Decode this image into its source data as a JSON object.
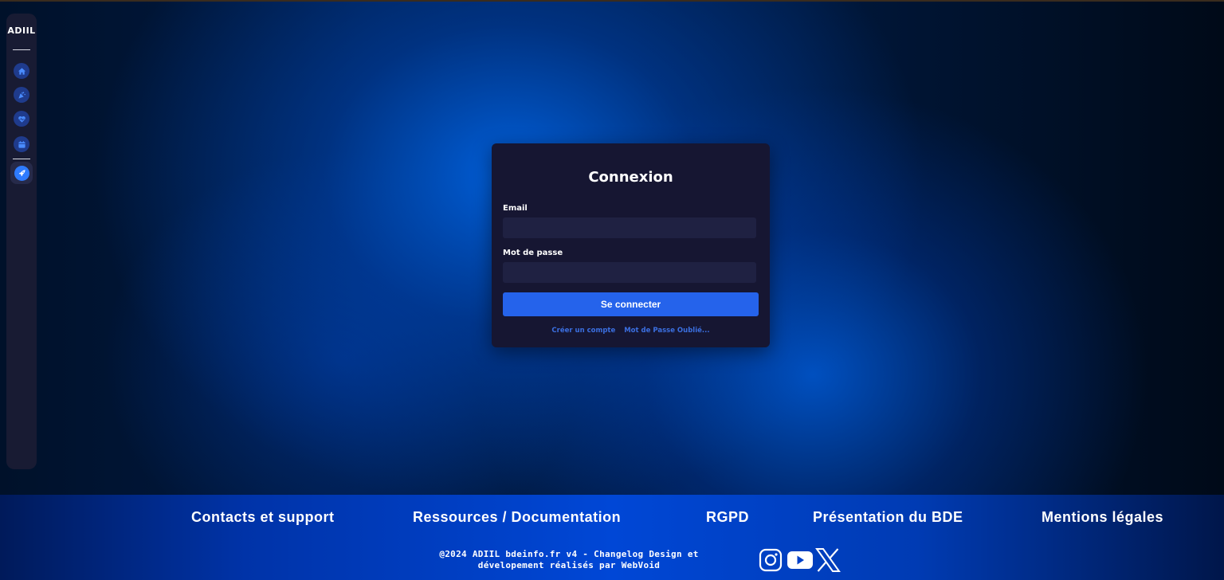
{
  "sidebar": {
    "logo": "ADIIL",
    "items": [
      {
        "icon": "home-icon"
      },
      {
        "icon": "party-popper-icon"
      },
      {
        "icon": "heart-icon"
      },
      {
        "icon": "calendar-icon"
      },
      {
        "icon": "rocket-icon",
        "active": true
      }
    ]
  },
  "login": {
    "title": "Connexion",
    "email_label": "Email",
    "email_value": "",
    "password_label": "Mot de passe",
    "password_value": "",
    "submit_label": "Se connecter",
    "create_account": "Créer un compte",
    "forgot_password": "Mot de Passe Oublié..."
  },
  "footer": {
    "links": [
      "Contacts et support",
      "Ressources / Documentation",
      "RGPD",
      "Présentation du BDE",
      "Mentions légales"
    ],
    "copyright_line1": "@2024 ADIIL bdeinfo.fr v4 - Changelog Design et",
    "copyright_line2": "dévelopement réalisés par WebVoid",
    "social": [
      "instagram-icon",
      "youtube-icon",
      "x-icon"
    ]
  },
  "colors": {
    "accent": "#2563eb",
    "card": "#161632",
    "input": "#1f2142",
    "sidebar": "#181b33",
    "link": "#3b6fe0"
  }
}
